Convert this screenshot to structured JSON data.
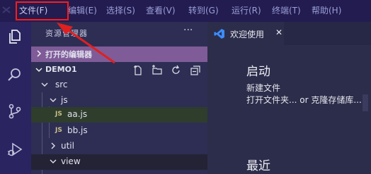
{
  "menubar": {
    "items": [
      {
        "label": "文件(F)"
      },
      {
        "label": "编辑(E)"
      },
      {
        "label": "选择(S)"
      },
      {
        "label": "查看(V)"
      },
      {
        "label": "转到(G)"
      },
      {
        "label": "运行(R)"
      },
      {
        "label": "终端(T)"
      },
      {
        "label": "帮助(H)"
      }
    ],
    "highlight_color": "#ff1a1a"
  },
  "activity_bar": {
    "icons": [
      "files-icon",
      "search-icon",
      "source-control-icon",
      "run-debug-icon"
    ]
  },
  "sidebar": {
    "title": "资源管理器",
    "more_label": "···",
    "open_editors_label": "打开的编辑器",
    "project_label": "DEMO1",
    "toolbar_icons": [
      "new-file-icon",
      "new-folder-icon",
      "refresh-icon",
      "collapse-all-icon"
    ],
    "tree": {
      "src": "src",
      "js": "js",
      "aa": "aa.js",
      "bb": "bb.js",
      "util": "util",
      "view": "view",
      "badge": "JS"
    }
  },
  "editor": {
    "tab_label": "欢迎使用",
    "tab_close": "✕",
    "start_heading": "启动",
    "new_file": "新建文件",
    "open_clone": "打开文件夹... or 克隆存储库...",
    "recent_heading": "最近"
  },
  "colors": {
    "accent_blue": "#3c8cff",
    "open_editors_bg": "#7f5c98",
    "arrow": "#e02020"
  }
}
